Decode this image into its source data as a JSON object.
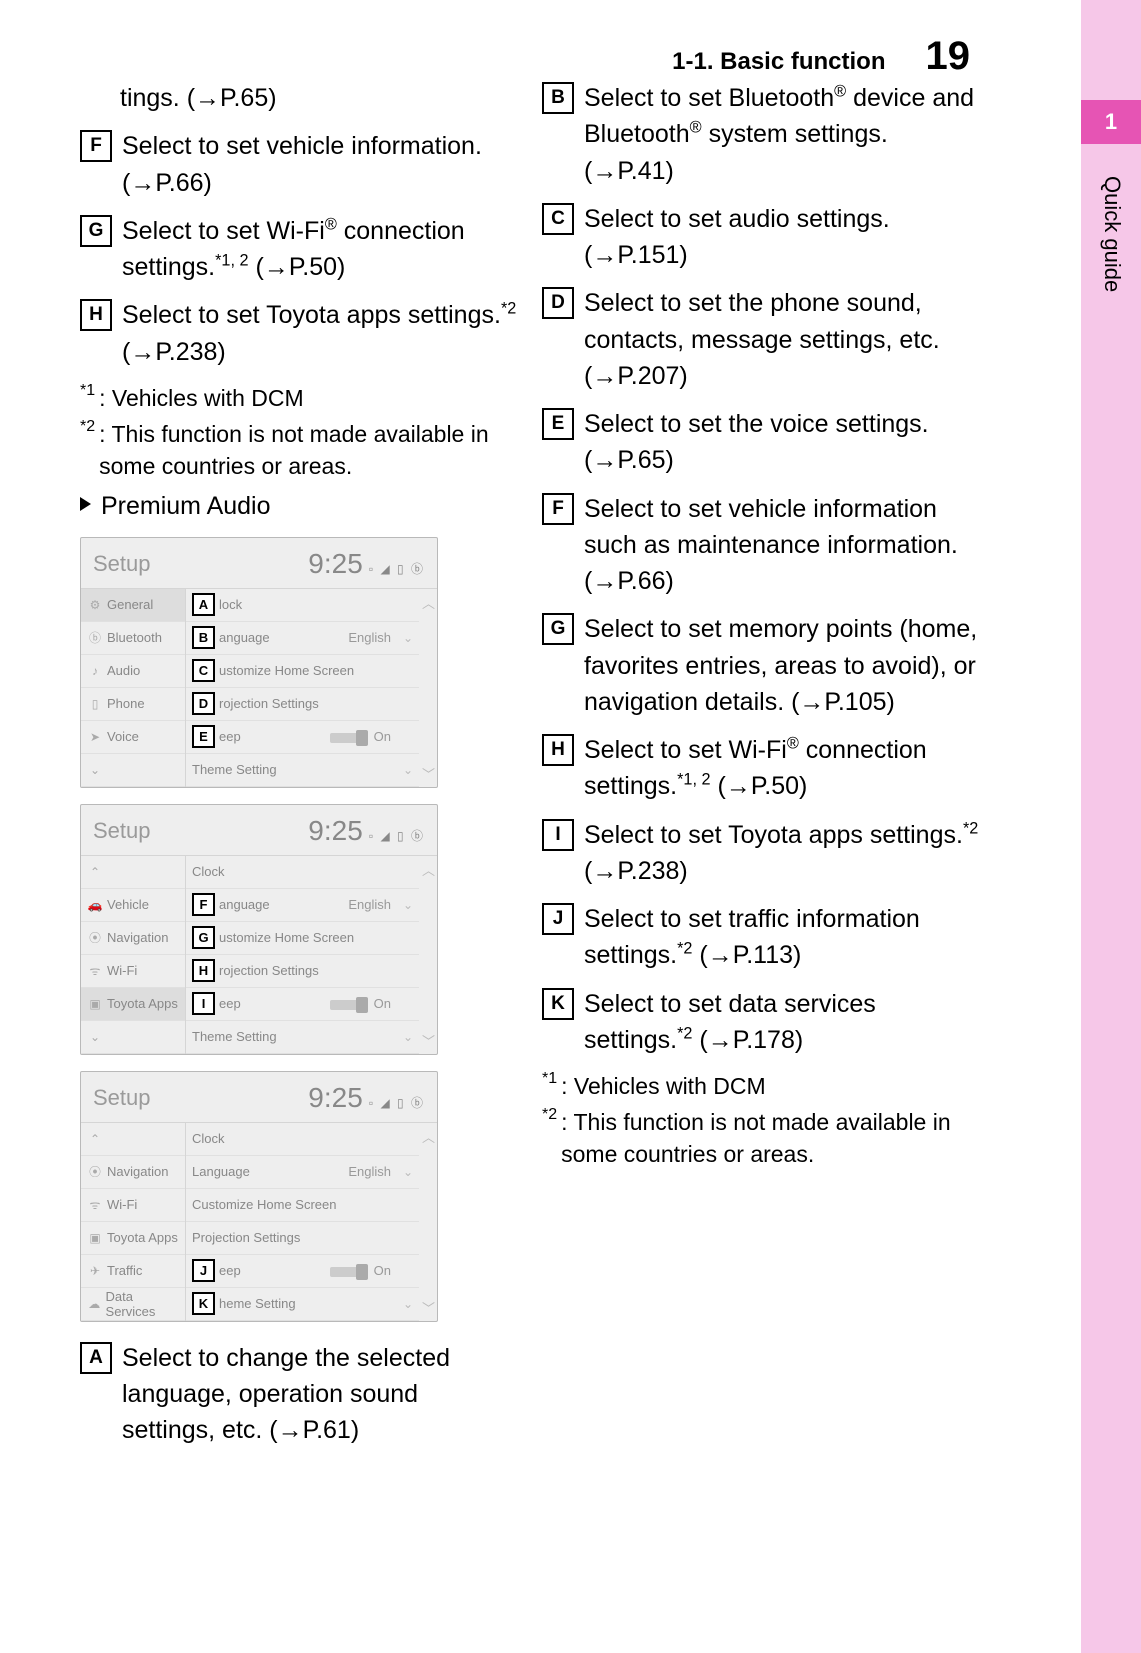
{
  "header": {
    "section": "1-1. Basic function",
    "page_number": "19"
  },
  "side": {
    "chapter": "1",
    "label": "Quick guide"
  },
  "left": {
    "first_line": "tings. (→P.65)",
    "items_top": [
      {
        "letter": "F",
        "text": "Select to set vehicle information. (→P.66)"
      },
      {
        "letter": "G",
        "text": "Select to set Wi-Fi",
        "sup1": "®",
        "after1": " connection settings.",
        "sup2": "*1, 2",
        "after2": " (→P.50)"
      },
      {
        "letter": "H",
        "text": "Select to set Toyota apps settings.",
        "sup1": "*2",
        "after1": " (→P.238)"
      }
    ],
    "footnotes_top": [
      {
        "mark": "*1",
        "text": ": Vehicles with DCM"
      },
      {
        "mark": "*2",
        "text": ": This function is not made available in some countries or areas."
      }
    ],
    "subhead": "Premium Audio",
    "screens": [
      {
        "title": "Setup",
        "time": "9:25",
        "nav": [
          {
            "icon": "⚙",
            "label": "General",
            "sel": true
          },
          {
            "icon": "ⓑ",
            "label": "Bluetooth"
          },
          {
            "icon": "♪",
            "label": "Audio"
          },
          {
            "icon": "▯",
            "label": "Phone"
          },
          {
            "icon": "➤",
            "label": "Voice"
          },
          {
            "icon": "⌄",
            "label": ""
          }
        ],
        "list": [
          {
            "letter": "A",
            "label": "lock"
          },
          {
            "letter": "B",
            "label": "anguage",
            "value": "English",
            "chev": true
          },
          {
            "letter": "C",
            "label": "ustomize Home Screen"
          },
          {
            "letter": "D",
            "label": "rojection Settings"
          },
          {
            "letter": "E",
            "label": "eep",
            "toggle": true,
            "value": "On"
          },
          {
            "label": "Theme Setting",
            "chev": true
          }
        ]
      },
      {
        "title": "Setup",
        "time": "9:25",
        "nav": [
          {
            "icon": "⌃",
            "label": ""
          },
          {
            "icon": "🚗",
            "label": "Vehicle"
          },
          {
            "icon": "⦿",
            "label": "Navigation"
          },
          {
            "icon": "ᯤ",
            "label": "Wi-Fi"
          },
          {
            "icon": "▣",
            "label": "Toyota Apps",
            "sel": true
          },
          {
            "icon": "⌄",
            "label": ""
          }
        ],
        "list": [
          {
            "label": "Clock"
          },
          {
            "letter": "F",
            "label": "anguage",
            "value": "English",
            "chev": true
          },
          {
            "letter": "G",
            "label": "ustomize Home Screen"
          },
          {
            "letter": "H",
            "label": "rojection Settings"
          },
          {
            "letter": "I",
            "label": "eep",
            "toggle": true,
            "value": "On"
          },
          {
            "label": "Theme Setting",
            "chev": true
          }
        ]
      },
      {
        "title": "Setup",
        "time": "9:25",
        "nav": [
          {
            "icon": "⌃",
            "label": ""
          },
          {
            "icon": "⦿",
            "label": "Navigation"
          },
          {
            "icon": "ᯤ",
            "label": "Wi-Fi"
          },
          {
            "icon": "▣",
            "label": "Toyota Apps"
          },
          {
            "icon": "✈",
            "label": "Traffic"
          },
          {
            "icon": "☁",
            "label": "Data Services"
          }
        ],
        "list": [
          {
            "label": "Clock"
          },
          {
            "label": "Language",
            "value": "English",
            "chev": true
          },
          {
            "label": "Customize Home Screen"
          },
          {
            "label": "Projection Settings"
          },
          {
            "letter": "J",
            "label": "eep",
            "toggle": true,
            "value": "On"
          },
          {
            "letter": "K",
            "label": "heme Setting",
            "chev": true
          }
        ]
      }
    ],
    "item_bottom": {
      "letter": "A",
      "text": "Select to change the selected language, operation sound settings, etc. (→P.61)"
    }
  },
  "right": {
    "items": [
      {
        "letter": "B",
        "pre": "Select to set Bluetooth",
        "sup1": "®",
        "mid": " device and Bluetooth",
        "sup2": "®",
        "post": " system settings. (→P.41)"
      },
      {
        "letter": "C",
        "text": "Select to set audio settings. (→P.151)"
      },
      {
        "letter": "D",
        "text": "Select to set the phone sound, contacts, message settings, etc. (→P.207)"
      },
      {
        "letter": "E",
        "text": "Select to set the voice settings. (→P.65)"
      },
      {
        "letter": "F",
        "text": "Select to set vehicle information such as maintenance information. (→P.66)"
      },
      {
        "letter": "G",
        "text": "Select to set memory points (home, favorites entries, areas to avoid), or navigation details. (→P.105)"
      },
      {
        "letter": "H",
        "pre": "Select to set Wi-Fi",
        "sup1": "®",
        "mid": " connection settings.",
        "sup2": "*1, 2",
        "post": " (→P.50)"
      },
      {
        "letter": "I",
        "pre": "Select to set Toyota apps settings.",
        "sup1": "*2",
        "post": " (→P.238)"
      },
      {
        "letter": "J",
        "pre": "Select to set traffic information settings.",
        "sup1": "*2",
        "post": " (→P.113)"
      },
      {
        "letter": "K",
        "pre": "Select to set data services settings.",
        "sup1": "*2",
        "post": " (→P.178)"
      }
    ],
    "footnotes": [
      {
        "mark": "*1",
        "text": ": Vehicles with DCM"
      },
      {
        "mark": "*2",
        "text": ": This function is not made available in some countries or areas."
      }
    ]
  }
}
